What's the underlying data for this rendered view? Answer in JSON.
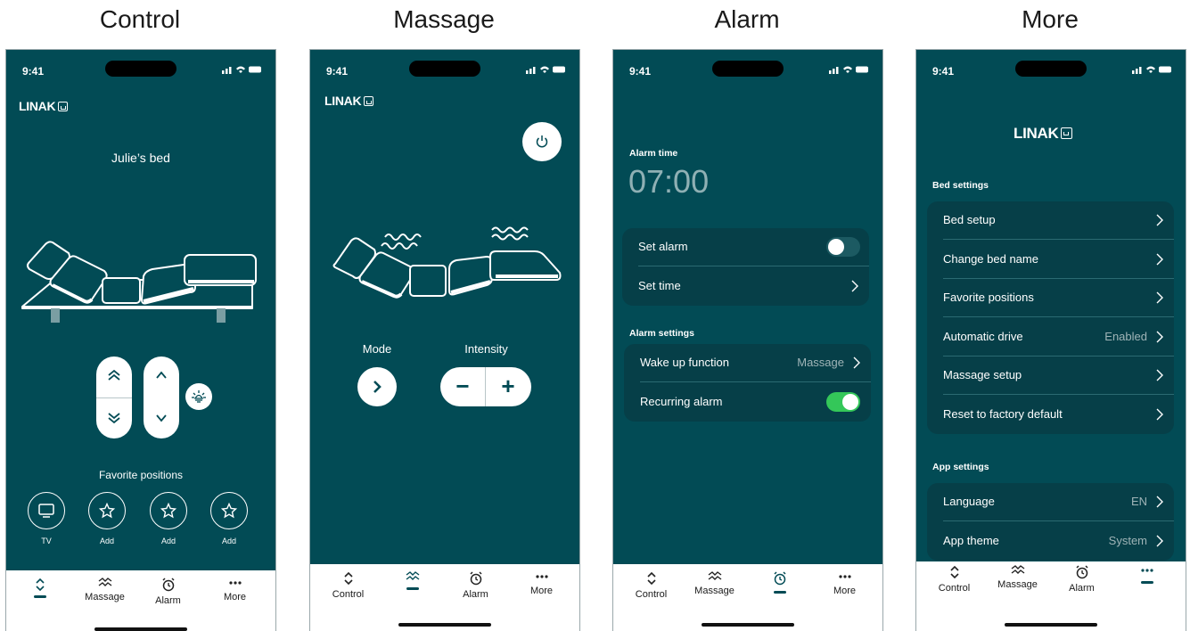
{
  "titles": [
    "Control",
    "Massage",
    "Alarm",
    "More"
  ],
  "status": {
    "time": "9:41"
  },
  "brand": {
    "logo_text": "LINAK"
  },
  "tabs": {
    "control": "Control",
    "massage": "Massage",
    "alarm": "Alarm",
    "more": "More"
  },
  "control": {
    "bed_name": "Julie’s bed",
    "favorites_title": "Favorite positions",
    "favorites": [
      {
        "label": "TV",
        "icon": "tv-icon"
      },
      {
        "label": "Add",
        "icon": "star-icon"
      },
      {
        "label": "Add",
        "icon": "star-icon"
      },
      {
        "label": "Add",
        "icon": "star-icon"
      }
    ],
    "active_tab": "control"
  },
  "massage": {
    "mode_label": "Mode",
    "intensity_label": "Intensity",
    "minus": "−",
    "plus": "+",
    "active_tab": "massage"
  },
  "alarm": {
    "alarm_time_label": "Alarm time",
    "alarm_time": "07:00",
    "set_alarm": "Set alarm",
    "set_alarm_on": false,
    "set_time": "Set time",
    "settings_title": "Alarm settings",
    "wake_up": "Wake up function",
    "wake_up_value": "Massage",
    "recurring": "Recurring alarm",
    "recurring_on": true,
    "active_tab": "alarm"
  },
  "more": {
    "bed_settings_title": "Bed settings",
    "bed_settings": [
      {
        "label": "Bed setup",
        "value": ""
      },
      {
        "label": "Change bed name",
        "value": ""
      },
      {
        "label": "Favorite positions",
        "value": ""
      },
      {
        "label": "Automatic drive",
        "value": "Enabled"
      },
      {
        "label": "Massage setup",
        "value": ""
      },
      {
        "label": "Reset to factory default",
        "value": ""
      }
    ],
    "app_settings_title": "App settings",
    "app_settings": [
      {
        "label": "Language",
        "value": "EN"
      },
      {
        "label": "App theme",
        "value": "System"
      }
    ],
    "active_tab": "more"
  },
  "colors": {
    "brand_teal": "#024b55",
    "toggle_on": "#34c759",
    "toggle_off": "#1c5a62"
  }
}
